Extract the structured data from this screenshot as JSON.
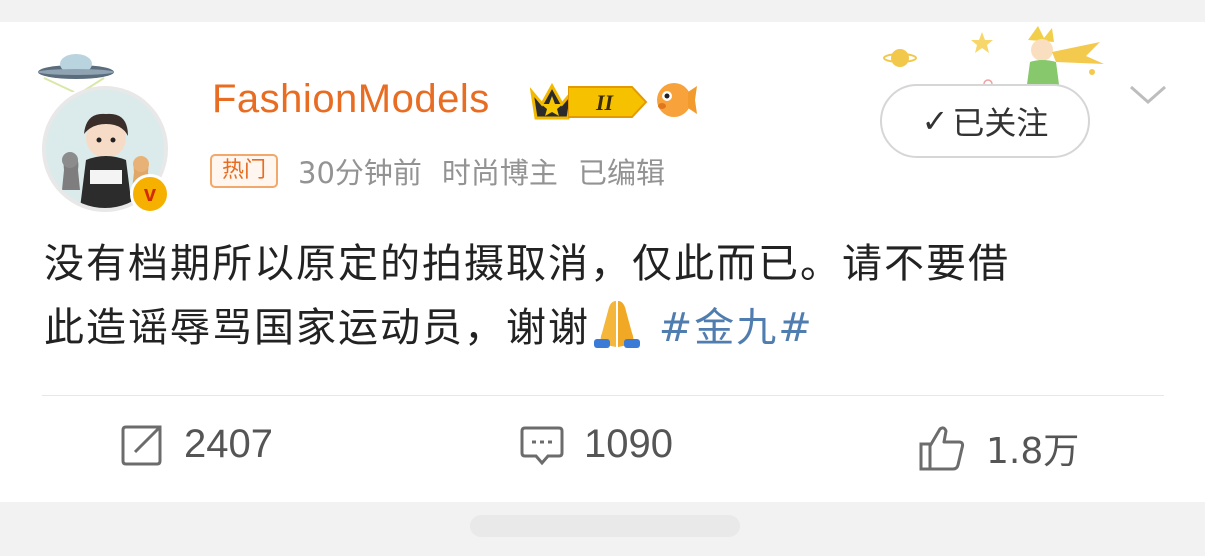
{
  "post": {
    "username": "FashionModels",
    "level_badge": "II",
    "hot_tag": "热门",
    "time": "30分钟前",
    "category": "时尚博主",
    "edited": "已编辑",
    "follow_label": "已关注",
    "text_line1": "没有档期所以原定的拍摄取消，仅此而已。请不要借",
    "text_line2": "此造谣辱骂国家运动员，谢谢",
    "hashtag": "#金九#"
  },
  "actions": {
    "repost_count": "2407",
    "comment_count": "1090",
    "like_count": "1.8万"
  },
  "colors": {
    "username": "#e86c21",
    "hashtag": "#507daf",
    "meta": "#939393"
  },
  "icons": [
    "ufo-icon",
    "avatar",
    "verified-icon",
    "crown-icon",
    "level-badge",
    "fish-icon",
    "planet-icon",
    "star-icon",
    "little-prince-icon",
    "check-icon",
    "chevron-down-icon",
    "share-icon",
    "comment-icon",
    "like-icon",
    "pray-emoji"
  ]
}
